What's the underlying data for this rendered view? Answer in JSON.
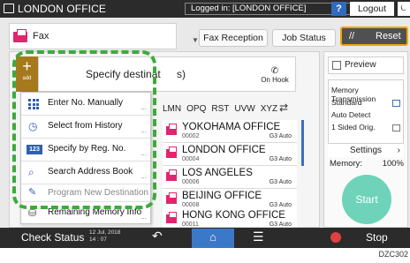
{
  "topbar": {
    "title": "LONDON OFFICE",
    "login_status": "Logged in: [LONDON OFFICE]",
    "help_label": "?",
    "logout_label": "Logout",
    "power_label": "⏾"
  },
  "function": {
    "fax_label": "Fax",
    "fax_reception_label": "Fax Reception",
    "job_status_label": "Job Status",
    "reset_label": "Reset",
    "reset_icon": "//"
  },
  "destination": {
    "add_label": "add",
    "add_symbol": "+",
    "field_text_left": "Specify destinat",
    "field_text_right": "s)",
    "on_hook_label": "On Hook"
  },
  "alpha_tabs": [
    "LMN",
    "OPQ",
    "RST",
    "UVW",
    "XYZ"
  ],
  "menu": {
    "items": [
      {
        "label": "Enter No. Manually",
        "icon": "grid-icon"
      },
      {
        "label": "Select from History",
        "icon": "clock-icon"
      },
      {
        "label": "Specify by Reg. No.",
        "icon": "reg-number-icon",
        "icon_text": "123"
      },
      {
        "label": "Search Address Book",
        "icon": "search-icon"
      },
      {
        "label": "Program New Destination",
        "icon": "program-icon"
      },
      {
        "label": "Remaining Memory Info",
        "icon": "memory-icon"
      }
    ]
  },
  "destinations": [
    {
      "name": "YOKOHAMA OFFICE",
      "number": "00002",
      "mode": "G3 Auto"
    },
    {
      "name": "LONDON OFFICE",
      "number": "00004",
      "mode": "G3 Auto"
    },
    {
      "name": "LOS ANGELES",
      "number": "00006",
      "mode": "G3 Auto"
    },
    {
      "name": "BEIJING OFFICE",
      "number": "00008",
      "mode": "G3 Auto"
    },
    {
      "name": "HONG KONG OFFICE",
      "number": "00011",
      "mode": "G3 Auto"
    }
  ],
  "right_panel": {
    "preview_label": "Preview",
    "lines": [
      "Memory Transmission",
      "Standard",
      "Auto Detect",
      "1 Sided Orig."
    ],
    "settings_label": "Settings",
    "memory_label": "Memory:",
    "memory_value": "100%",
    "start_label": "Start"
  },
  "bottombar": {
    "status_label": "Check Status",
    "date": "12 Jul, 2018",
    "time": "14 : 07",
    "stop_label": "Stop"
  },
  "caption": "DZC302",
  "colors": {
    "accent_blue": "#3b78c8",
    "fax_pink": "#e0266e",
    "add_gold": "#a67a1c",
    "highlight_green": "#3daa3c",
    "start_teal": "#6ed3b9",
    "reset_border": "#f0a500"
  }
}
